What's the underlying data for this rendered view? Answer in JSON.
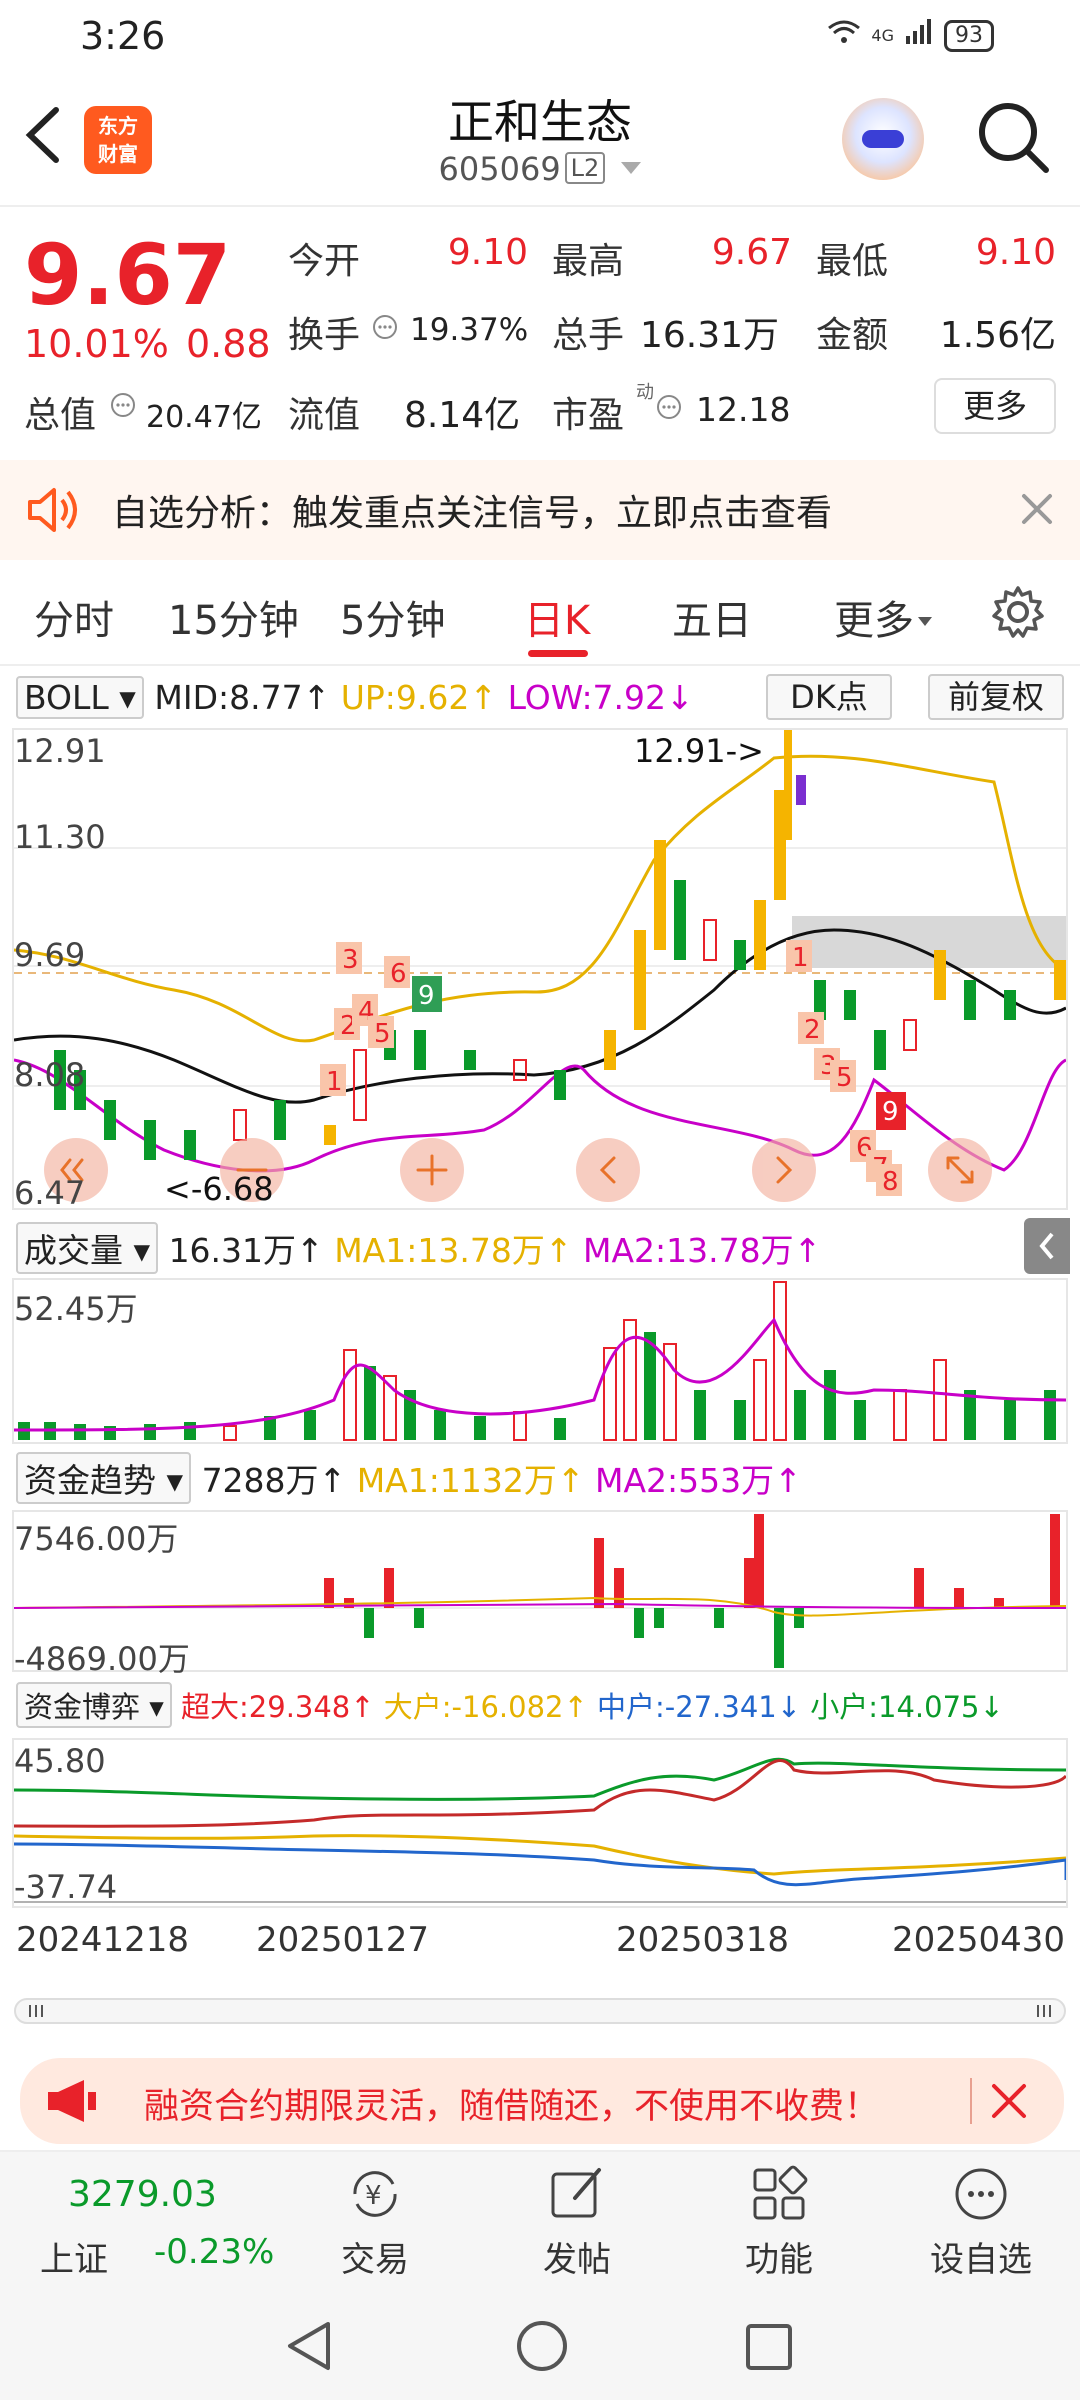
{
  "status_bar": {
    "time": "3:26",
    "network": "4G",
    "battery": "93"
  },
  "header": {
    "logo_text_1": "东方",
    "logo_text_2": "财富",
    "stock_name": "正和生态",
    "stock_code": "605069",
    "level_badge": "L2"
  },
  "quote": {
    "price": "9.67",
    "change_pct": "10.01%",
    "change_abs": "0.88",
    "open_label": "今开",
    "open": "9.10",
    "high_label": "最高",
    "high": "9.67",
    "low_label": "最低",
    "low": "9.10",
    "turnover_label": "换手",
    "turnover": "19.37%",
    "volume_label": "总手",
    "volume": "16.31万",
    "amount_label": "金额",
    "amount": "1.56亿",
    "total_mv_label": "总值",
    "total_mv": "20.47亿",
    "float_mv_label": "流值",
    "float_mv": "8.14亿",
    "pe_label": "市盈",
    "pe_sup": "动",
    "pe": "12.18",
    "more_label": "更多"
  },
  "alert": {
    "text": "自选分析：触发重点关注信号，立即点击查看"
  },
  "tabs": [
    {
      "label": "分时",
      "active": false
    },
    {
      "label": "15分钟",
      "active": false
    },
    {
      "label": "5分钟",
      "active": false
    },
    {
      "label": "日K",
      "active": true
    },
    {
      "label": "五日",
      "active": false
    },
    {
      "label": "更多",
      "active": false
    }
  ],
  "boll": {
    "selector": "BOLL",
    "mid": "MID:8.77↑",
    "up": "UP:9.62↑",
    "low": "LOW:7.92↓",
    "dk_label": "DK点",
    "fq_label": "前复权",
    "y_labels": [
      "12.91",
      "11.30",
      "9.69",
      "8.08",
      "6.47"
    ],
    "high_marker": "12.91->",
    "low_marker": "<-6.68"
  },
  "volume": {
    "selector": "成交量",
    "value": "16.31万↑",
    "ma1": "MA1:13.78万↑",
    "ma2": "MA2:13.78万↑",
    "y_label": "52.45万"
  },
  "fund_trend": {
    "selector": "资金趋势",
    "value": "7288万↑",
    "ma1": "MA1:1132万↑",
    "ma2": "MA2:553万↑",
    "y_top": "7546.00万",
    "y_bottom": "-4869.00万"
  },
  "fund_game": {
    "selector": "资金博弈",
    "super": "超大:29.348↑",
    "large": "大户:-16.082↑",
    "mid": "中户:-27.341↓",
    "small": "小户:14.075↓",
    "y_top": "45.80",
    "y_bottom": "-37.74"
  },
  "dates": [
    "20241218",
    "20250127",
    "20250318",
    "20250430"
  ],
  "promo": {
    "text": "融资合约期限灵活，随借随还，不使用不收费！"
  },
  "bottom_nav": {
    "index_value": "3279.03",
    "index_name": "上证",
    "index_change": "-0.23%",
    "items": [
      "交易",
      "发帖",
      "功能",
      "设自选"
    ]
  },
  "colors": {
    "up": "#e8222a",
    "down": "#0a9a2a",
    "accent": "#ff5a1f"
  }
}
